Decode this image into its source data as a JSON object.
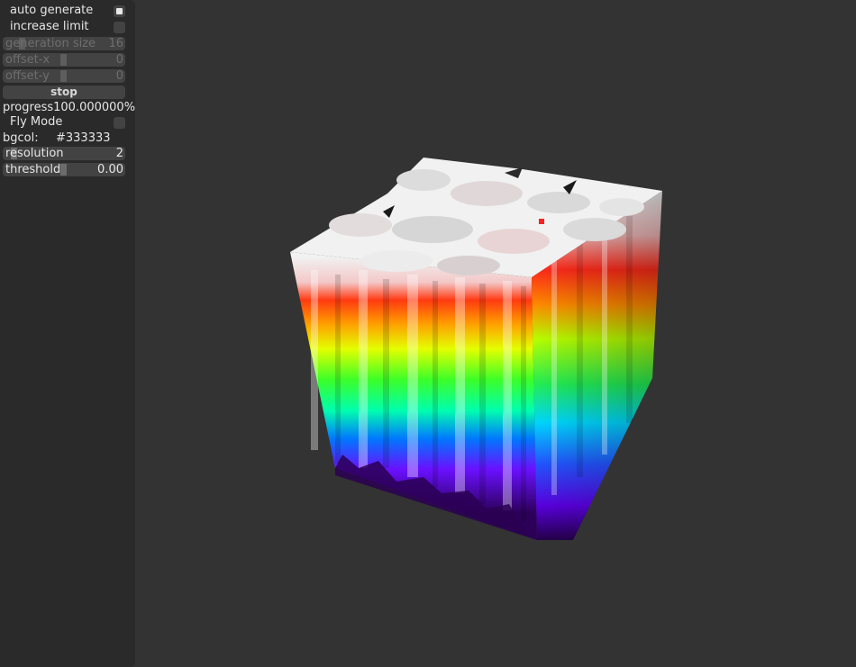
{
  "panel": {
    "auto_generate": {
      "label": "auto generate",
      "checked": true
    },
    "increase_limit": {
      "label": "increase limit",
      "checked": false
    },
    "generation_size": {
      "label": "generation size",
      "value": "16",
      "disabled": true
    },
    "offset_x": {
      "label": "offset-x",
      "value": "0",
      "disabled": true
    },
    "offset_y": {
      "label": "offset-y",
      "value": "0",
      "disabled": true
    },
    "stop_button": {
      "label": "stop"
    },
    "progress": {
      "label": "progress",
      "value": "100.000000%"
    },
    "fly_mode": {
      "label": "Fly Mode",
      "checked": false
    },
    "bgcol": {
      "label": "bgcol:",
      "value": "#333333"
    },
    "resolution": {
      "label": "resolution",
      "value": "2"
    },
    "threshold": {
      "label": "threshold",
      "value": "0.00"
    }
  },
  "colors": {
    "background": "#333333",
    "panel": "#2a2a2a",
    "control": "#434343",
    "bands": [
      "#f2f2f2",
      "#ff2a00",
      "#ffaa00",
      "#d6ff00",
      "#33ff22",
      "#00ffaa",
      "#0077ff",
      "#6a00ff",
      "#3a0070"
    ]
  }
}
